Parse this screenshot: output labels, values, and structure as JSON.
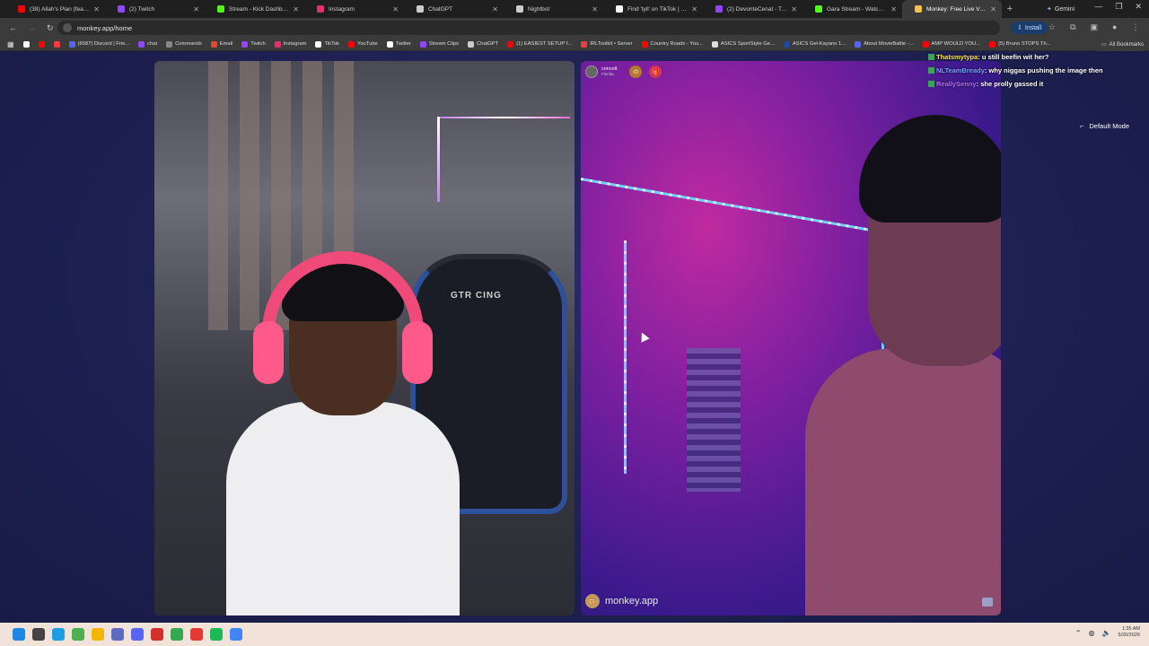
{
  "browser": {
    "tabs": [
      {
        "title": "(38) Allah's Plan (feat. Kanye",
        "color": "#ff0000"
      },
      {
        "title": "(2) Twitch",
        "color": "#9146ff"
      },
      {
        "title": "Stream - Kick Dashboard",
        "color": "#53fc18"
      },
      {
        "title": "Instagram",
        "color": "#e1306c"
      },
      {
        "title": "ChatGPT",
        "color": "#cccccc"
      },
      {
        "title": "Nightbot",
        "color": "#cccccc"
      },
      {
        "title": "Find 'tyll' on TikTok | TikTo",
        "color": "#ffffff"
      },
      {
        "title": "(2) DevonteCenat - Twitch",
        "color": "#9146ff"
      },
      {
        "title": "Gara Stream - Watch Live o",
        "color": "#53fc18"
      },
      {
        "title": "Monkey: Free Live Video",
        "color": "#f2c14e",
        "active": true
      }
    ],
    "gemini_label": "Gemini",
    "url": "monkey.app/home",
    "install_label": "Install",
    "bookmarks": [
      {
        "label": "",
        "color": "#ffffff"
      },
      {
        "label": "",
        "color": "#ff0000"
      },
      {
        "label": "",
        "color": "#ff3a3a"
      },
      {
        "label": "(6587) Discord | Frie...",
        "color": "#5865f2"
      },
      {
        "label": "chat",
        "color": "#9146ff"
      },
      {
        "label": "Commands",
        "color": "#888888"
      },
      {
        "label": "Email",
        "color": "#ea4335"
      },
      {
        "label": "Twitch",
        "color": "#9146ff"
      },
      {
        "label": "Instagram",
        "color": "#e1306c"
      },
      {
        "label": "TikTok",
        "color": "#ffffff"
      },
      {
        "label": "YouTube",
        "color": "#ff0000"
      },
      {
        "label": "Twitter",
        "color": "#ffffff"
      },
      {
        "label": "Stream Clips",
        "color": "#9146ff"
      },
      {
        "label": "ChatGPT",
        "color": "#cccccc"
      },
      {
        "label": "(1) EASIEST SETUP f...",
        "color": "#ff0000"
      },
      {
        "label": "IRLToolkit • Server",
        "color": "#e04444"
      },
      {
        "label": "Country Roads - You...",
        "color": "#ff0000"
      },
      {
        "label": "ASICS SportStyle Ge...",
        "color": "#dddddd"
      },
      {
        "label": "ASICS Gel-Kayano 1...",
        "color": "#1b4aa0"
      },
      {
        "label": "About MovieBattle -...",
        "color": "#5865f2"
      },
      {
        "label": "AMP WOULD YOU...",
        "color": "#ff0000"
      },
      {
        "label": "(5) Bruno STOPS Th...",
        "color": "#ff0000"
      }
    ],
    "all_bookmarks_label": "All Bookmarks"
  },
  "page": {
    "left_user": {
      "name": "concelt",
      "sub": "Florida"
    },
    "brand": "monkey.app",
    "chat": [
      {
        "user": "Thatsmytypa",
        "msg": "u still beefin wit her?",
        "cls": "u1"
      },
      {
        "user": "NLTeamBready",
        "msg": "why niggas pushing the image then",
        "cls": "u2"
      },
      {
        "user": "ReallySenny",
        "msg": "she prolly gassed it",
        "cls": "u3"
      }
    ],
    "default_mode_label": "Default Mode",
    "chair_text": "GTR CING"
  },
  "taskbar": {
    "icons": [
      {
        "name": "windows-start-icon",
        "color": "#1e88e5"
      },
      {
        "name": "task-view-icon",
        "color": "#444444"
      },
      {
        "name": "edge-icon",
        "color": "#1b9de2"
      },
      {
        "name": "chrome-icon",
        "color": "#4caf50"
      },
      {
        "name": "file-explorer-icon",
        "color": "#f2b705"
      },
      {
        "name": "calculator-icon",
        "color": "#5c6bc0"
      },
      {
        "name": "discord-icon",
        "color": "#5865f2"
      },
      {
        "name": "app-red-icon",
        "color": "#d32f2f"
      },
      {
        "name": "app-chrome2-icon",
        "color": "#34a853"
      },
      {
        "name": "opera-icon",
        "color": "#e53935"
      },
      {
        "name": "spotify-icon",
        "color": "#1db954"
      },
      {
        "name": "chrome-active-icon",
        "color": "#4285f4"
      }
    ],
    "time": "1:35 AM",
    "date": "5/20/2026"
  }
}
